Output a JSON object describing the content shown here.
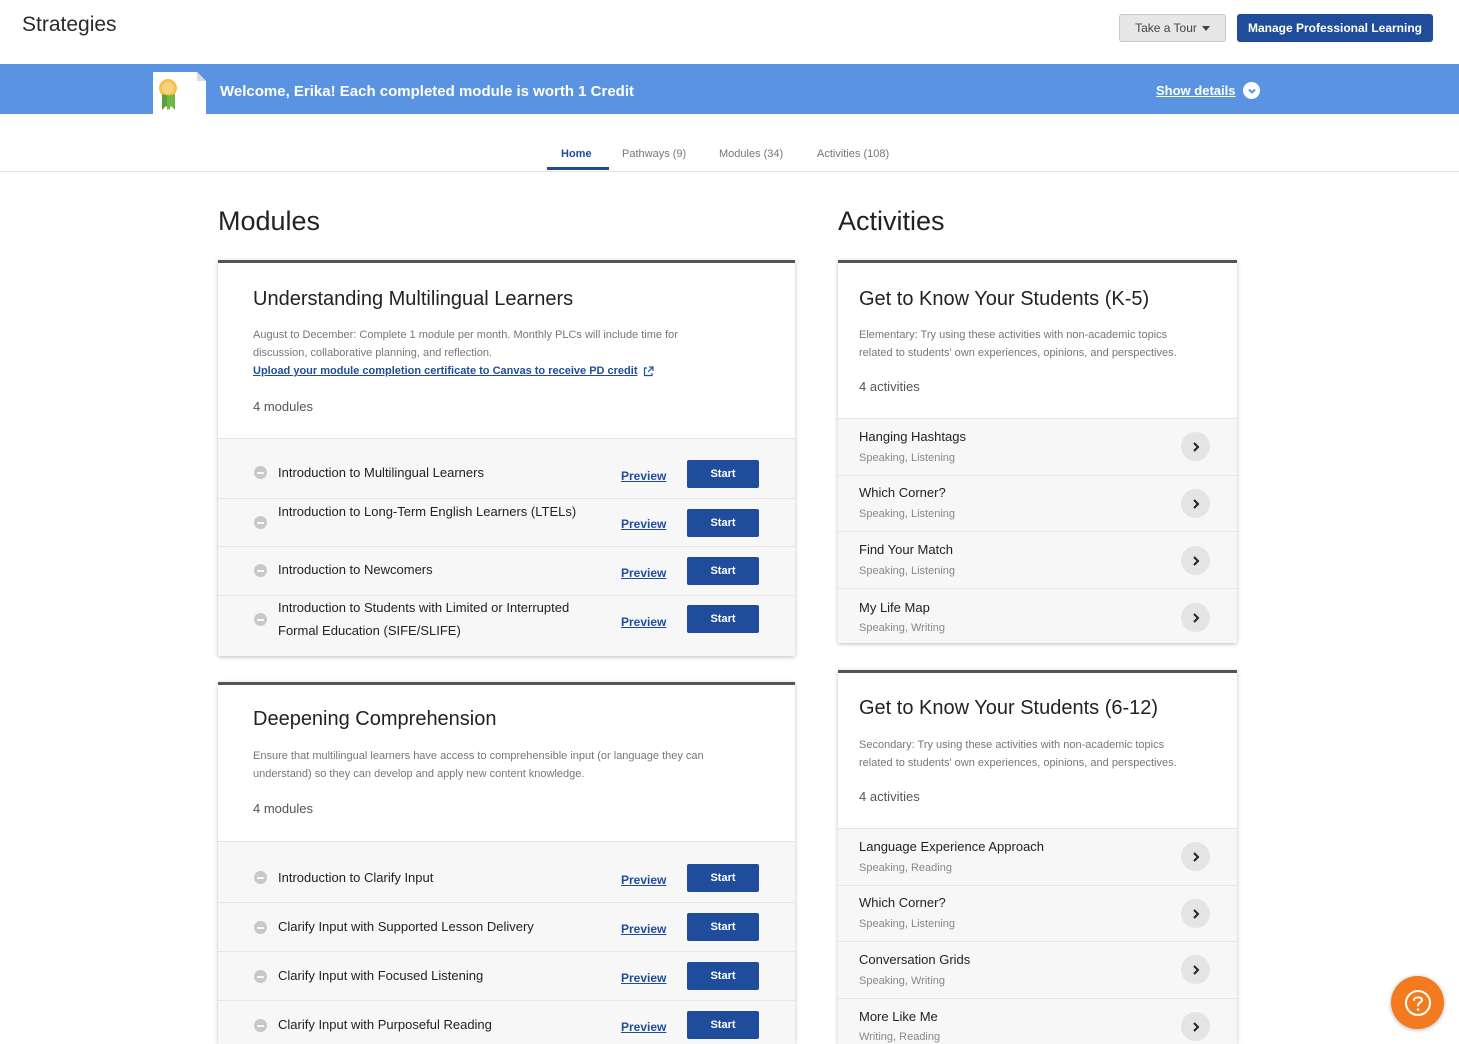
{
  "header": {
    "title": "Strategies",
    "tour_label": "Take a Tour",
    "manage_label": "Manage Professional Learning"
  },
  "banner": {
    "welcome_text": "Welcome, Erika! Each completed module is worth 1 Credit",
    "show_details_label": "Show details",
    "background_color": "#5b93e3"
  },
  "tabs": [
    {
      "label": "Home",
      "active": true
    },
    {
      "label": "Pathways (9)",
      "active": false
    },
    {
      "label": "Modules (34)",
      "active": false
    },
    {
      "label": "Activities (108)",
      "active": false
    }
  ],
  "modules_section": {
    "heading": "Modules",
    "cards": [
      {
        "title": "Understanding Multilingual Learners",
        "desc_line1": "August to December: Complete 1 module per month. Monthly PLCs will include time for",
        "desc_line2": "discussion, collaborative planning, and reflection.",
        "link": "Upload your module completion certificate to Canvas to receive PD credit",
        "count": "4 modules",
        "items": [
          {
            "label": "Introduction to Multilingual Learners",
            "preview": "Preview",
            "start": "Start"
          },
          {
            "label": "Introduction to Long-Term English Learners (LTELs)",
            "preview": "Preview",
            "start": "Start"
          },
          {
            "label": "Introduction to Newcomers",
            "preview": "Preview",
            "start": "Start"
          },
          {
            "label": "Introduction to Students with Limited or Interrupted Formal Education (SIFE/SLIFE)",
            "preview": "Preview",
            "start": "Start"
          }
        ]
      },
      {
        "title": "Deepening Comprehension",
        "desc_line1": "Ensure that multilingual learners have access to comprehensible input (or language they can",
        "desc_line2": "understand) so they can develop and apply new content knowledge.",
        "count": "4 modules",
        "items": [
          {
            "label": "Introduction to Clarify Input",
            "preview": "Preview",
            "start": "Start"
          },
          {
            "label": "Clarify Input with Supported Lesson Delivery",
            "preview": "Preview",
            "start": "Start"
          },
          {
            "label": "Clarify Input with Focused Listening",
            "preview": "Preview",
            "start": "Start"
          },
          {
            "label": "Clarify Input with Purposeful Reading",
            "preview": "Preview",
            "start": "Start"
          }
        ]
      }
    ]
  },
  "activities_section": {
    "heading": "Activities",
    "cards": [
      {
        "title": "Get to Know Your Students (K-5)",
        "desc_line1": "Elementary: Try using these activities with non-academic topics",
        "desc_line2": "related to students' own experiences, opinions, and perspectives.",
        "count": "4 activities",
        "items": [
          {
            "name": "Hanging Hashtags",
            "skills": "Speaking, Listening"
          },
          {
            "name": "Which Corner?",
            "skills": "Speaking, Listening"
          },
          {
            "name": "Find Your Match",
            "skills": "Speaking, Listening"
          },
          {
            "name": "My Life Map",
            "skills": "Speaking, Writing"
          }
        ]
      },
      {
        "title": "Get to Know Your Students (6-12)",
        "desc_line1": "Secondary: Try using these activities with non-academic topics",
        "desc_line2": "related to students' own experiences, opinions, and perspectives.",
        "count": "4 activities",
        "items": [
          {
            "name": "Language Experience Approach",
            "skills": "Speaking, Reading"
          },
          {
            "name": "Which Corner?",
            "skills": "Speaking, Listening"
          },
          {
            "name": "Conversation Grids",
            "skills": "Speaking, Writing"
          },
          {
            "name": "More Like Me",
            "skills": "Writing, Reading"
          }
        ]
      }
    ]
  },
  "colors": {
    "primary": "#1f4d9c",
    "help_button": "#f47a20"
  },
  "icons": {
    "certificate": "certificate-ribbon-icon",
    "chevron": "chevron-right-icon",
    "help": "question-mark-icon",
    "external": "external-link-icon"
  }
}
